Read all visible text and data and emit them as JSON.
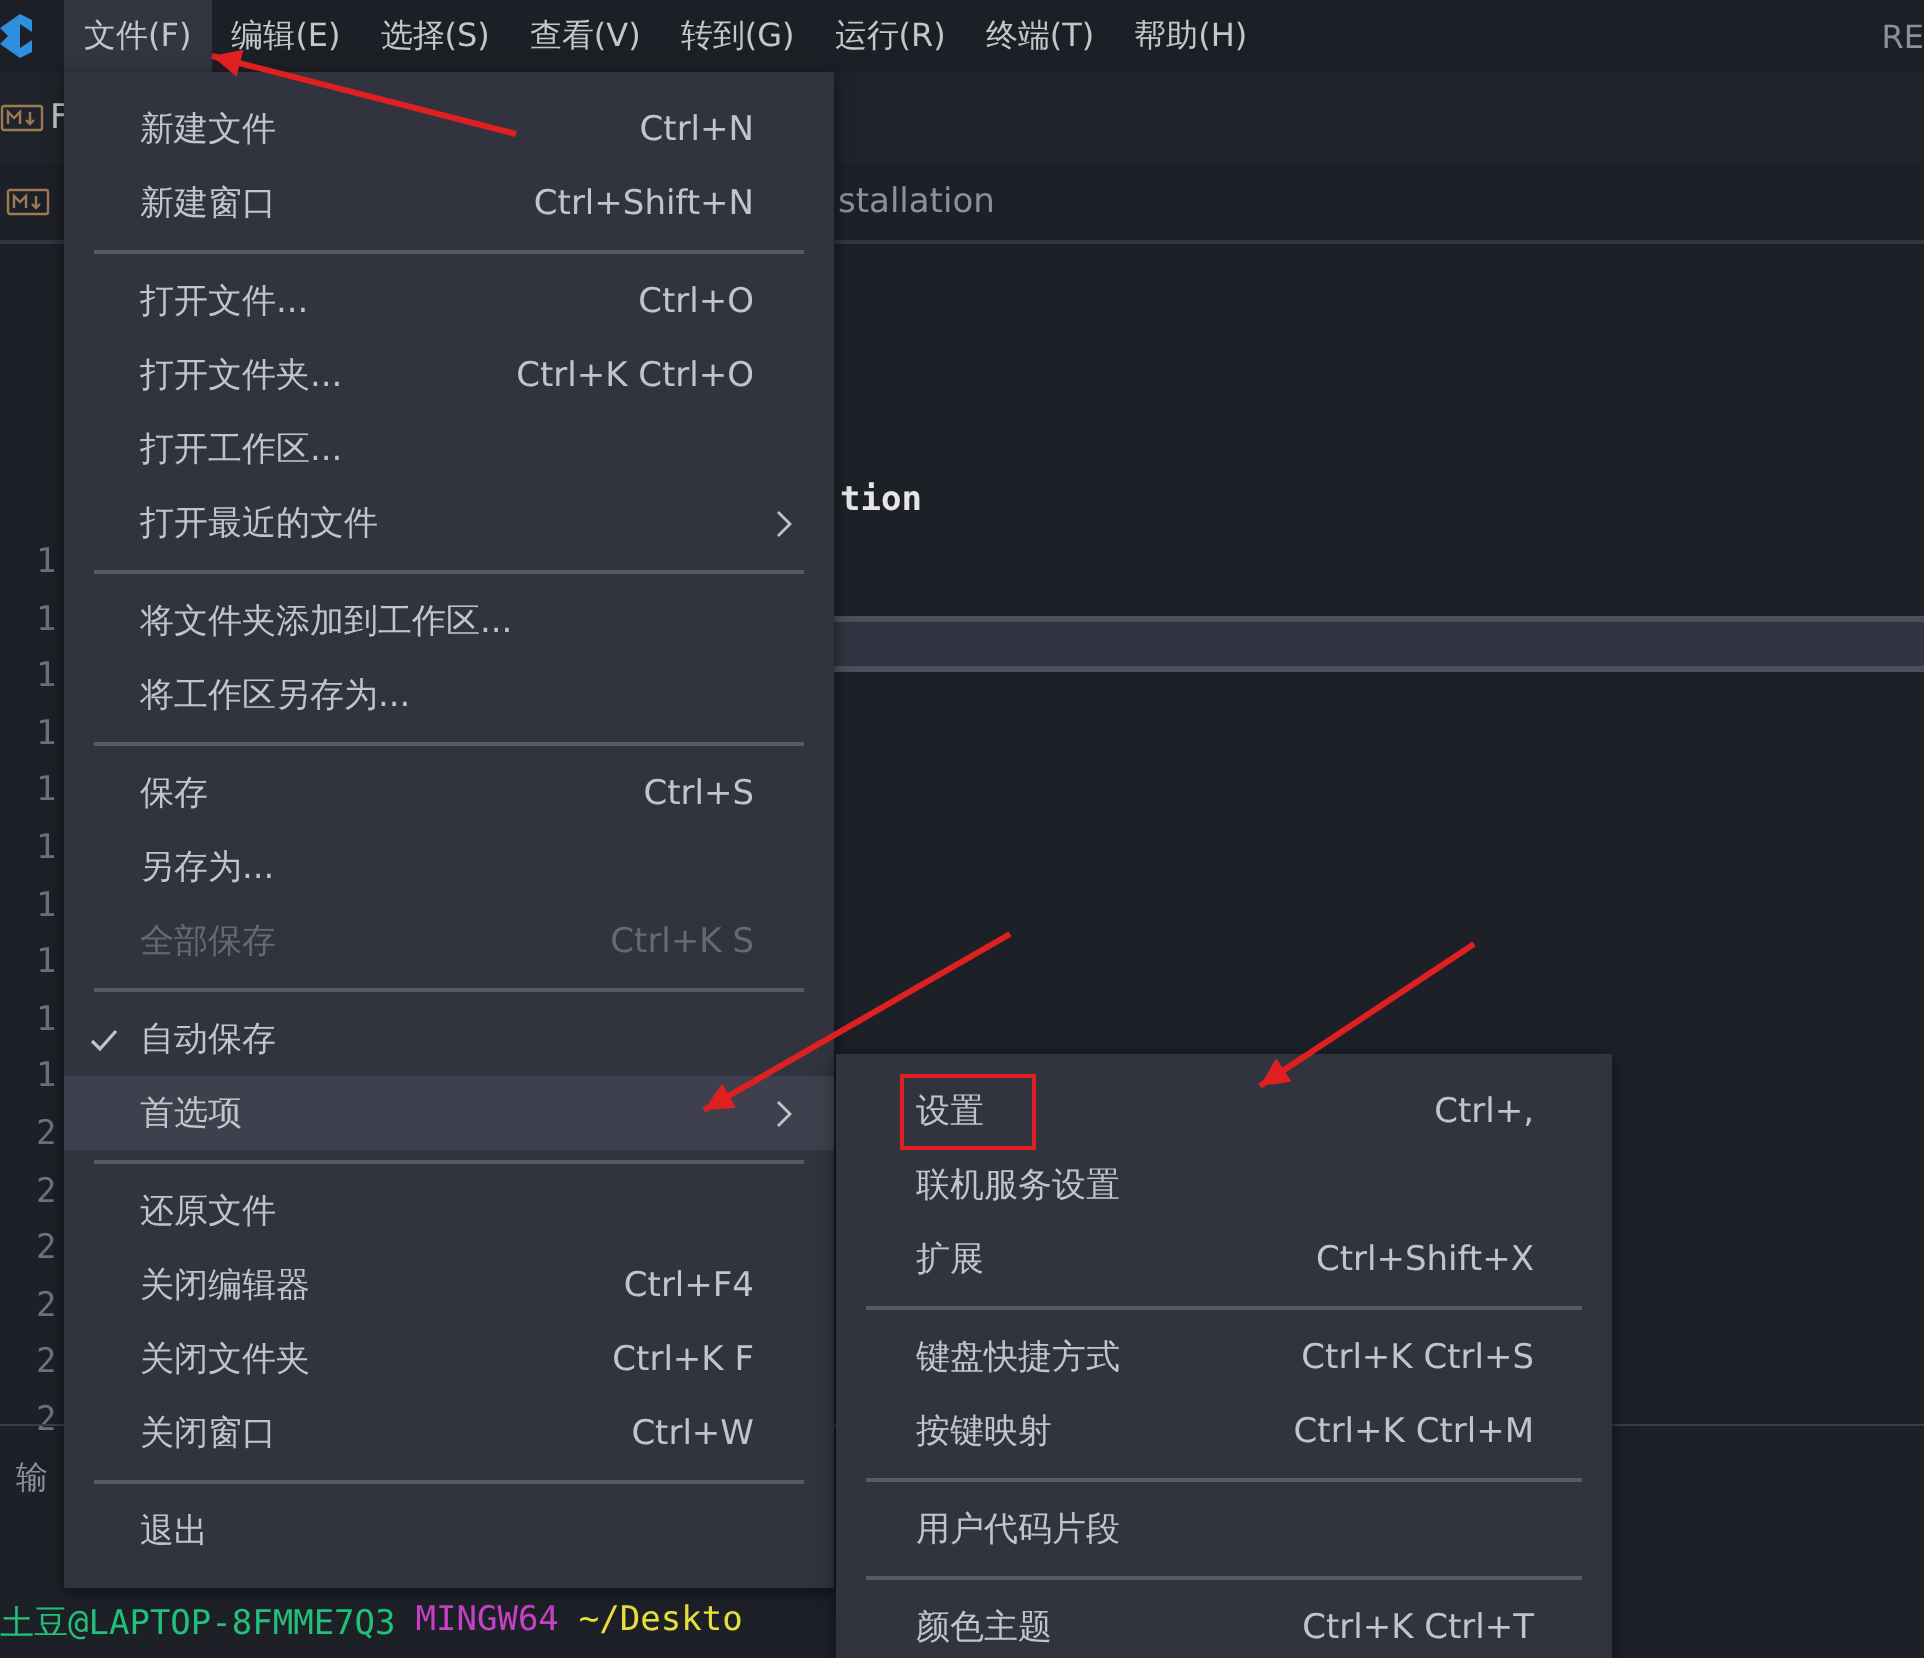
{
  "menubar": {
    "items": [
      {
        "label": "文件(F)",
        "selected": true
      },
      {
        "label": "编辑(E)",
        "selected": false
      },
      {
        "label": "选择(S)",
        "selected": false
      },
      {
        "label": "查看(V)",
        "selected": false
      },
      {
        "label": "转到(G)",
        "selected": false
      },
      {
        "label": "运行(R)",
        "selected": false
      },
      {
        "label": "终端(T)",
        "selected": false
      },
      {
        "label": "帮助(H)",
        "selected": false
      }
    ],
    "trailing_text": "RE"
  },
  "editor": {
    "tab_label": "F",
    "breadcrumb": "stallation",
    "code_text": "tion",
    "line_numbers": [
      "1",
      "1",
      "1",
      "1",
      "1",
      "1",
      "1",
      "1",
      "1",
      "1",
      "2",
      "2",
      "2",
      "2",
      "2",
      "2"
    ]
  },
  "panel": {
    "tab_label": "输",
    "terminal": {
      "user": "土豆@LAPTOP-8FMME7Q3",
      "system": "MINGW64",
      "path": "~/Deskto"
    }
  },
  "file_menu": {
    "groups": [
      [
        {
          "label": "新建文件",
          "shortcut": "Ctrl+N",
          "checked": false,
          "disabled": false,
          "submenu": false,
          "selected": false
        },
        {
          "label": "新建窗口",
          "shortcut": "Ctrl+Shift+N",
          "checked": false,
          "disabled": false,
          "submenu": false,
          "selected": false
        }
      ],
      [
        {
          "label": "打开文件...",
          "shortcut": "Ctrl+O",
          "checked": false,
          "disabled": false,
          "submenu": false,
          "selected": false
        },
        {
          "label": "打开文件夹...",
          "shortcut": "Ctrl+K Ctrl+O",
          "checked": false,
          "disabled": false,
          "submenu": false,
          "selected": false
        },
        {
          "label": "打开工作区...",
          "checked": false,
          "disabled": false,
          "submenu": false,
          "selected": false
        },
        {
          "label": "打开最近的文件",
          "checked": false,
          "disabled": false,
          "submenu": true,
          "selected": false
        }
      ],
      [
        {
          "label": "将文件夹添加到工作区...",
          "checked": false,
          "disabled": false,
          "submenu": false,
          "selected": false
        },
        {
          "label": "将工作区另存为...",
          "checked": false,
          "disabled": false,
          "submenu": false,
          "selected": false
        }
      ],
      [
        {
          "label": "保存",
          "shortcut": "Ctrl+S",
          "checked": false,
          "disabled": false,
          "submenu": false,
          "selected": false
        },
        {
          "label": "另存为...",
          "checked": false,
          "disabled": false,
          "submenu": false,
          "selected": false
        },
        {
          "label": "全部保存",
          "shortcut": "Ctrl+K S",
          "checked": false,
          "disabled": true,
          "submenu": false,
          "selected": false
        }
      ],
      [
        {
          "label": "自动保存",
          "checked": true,
          "disabled": false,
          "submenu": false,
          "selected": false
        },
        {
          "label": "首选项",
          "checked": false,
          "disabled": false,
          "submenu": true,
          "selected": true
        }
      ],
      [
        {
          "label": "还原文件",
          "checked": false,
          "disabled": false,
          "submenu": false,
          "selected": false
        },
        {
          "label": "关闭编辑器",
          "shortcut": "Ctrl+F4",
          "checked": false,
          "disabled": false,
          "submenu": false,
          "selected": false
        },
        {
          "label": "关闭文件夹",
          "shortcut": "Ctrl+K F",
          "checked": false,
          "disabled": false,
          "submenu": false,
          "selected": false
        },
        {
          "label": "关闭窗口",
          "shortcut": "Ctrl+W",
          "checked": false,
          "disabled": false,
          "submenu": false,
          "selected": false
        }
      ],
      [
        {
          "label": "退出",
          "checked": false,
          "disabled": false,
          "submenu": false,
          "selected": false
        }
      ]
    ]
  },
  "preferences_submenu": {
    "groups": [
      [
        {
          "label": "设置",
          "shortcut": "Ctrl+,",
          "highlighted": true
        },
        {
          "label": "联机服务设置",
          "highlighted": false
        },
        {
          "label": "扩展",
          "shortcut": "Ctrl+Shift+X",
          "highlighted": false
        }
      ],
      [
        {
          "label": "键盘快捷方式",
          "shortcut": "Ctrl+K Ctrl+S",
          "highlighted": false
        },
        {
          "label": "按键映射",
          "shortcut": "Ctrl+K Ctrl+M",
          "highlighted": false
        }
      ],
      [
        {
          "label": "用户代码片段",
          "highlighted": false
        }
      ],
      [
        {
          "label": "颜色主题",
          "shortcut": "Ctrl+K Ctrl+T",
          "highlighted": false
        }
      ]
    ]
  }
}
